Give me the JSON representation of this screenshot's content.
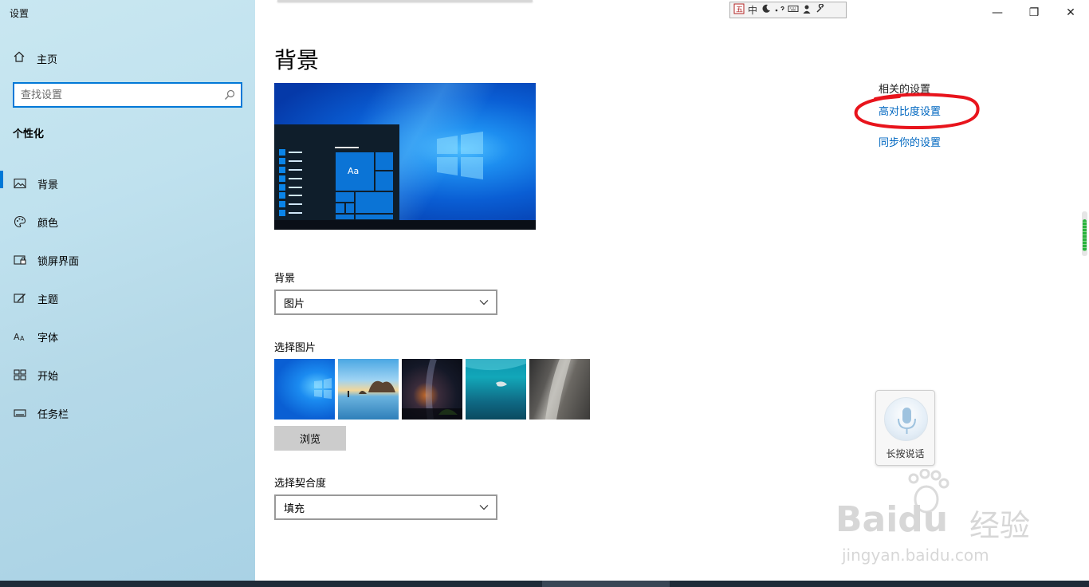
{
  "app": {
    "title": "设置"
  },
  "sidebar": {
    "home_label": "主页",
    "search": {
      "placeholder": "查找设置"
    },
    "section_title": "个性化",
    "items": [
      {
        "label": "背景",
        "icon": "picture-icon",
        "active": true
      },
      {
        "label": "颜色",
        "icon": "palette-icon",
        "active": false
      },
      {
        "label": "锁屏界面",
        "icon": "lockscreen-icon",
        "active": false
      },
      {
        "label": "主题",
        "icon": "theme-icon",
        "active": false
      },
      {
        "label": "字体",
        "icon": "font-icon",
        "active": false
      },
      {
        "label": "开始",
        "icon": "start-icon",
        "active": false
      },
      {
        "label": "任务栏",
        "icon": "taskbar-icon",
        "active": false
      }
    ]
  },
  "ime_bar": {
    "mode": "中",
    "icons": [
      "ime-logo-icon",
      "moon-icon",
      "punctuation-icon",
      "keyboard-icon",
      "user-icon",
      "wrench-icon"
    ]
  },
  "window_controls": {
    "minimize": "—",
    "restore": "❐",
    "close": "✕"
  },
  "main": {
    "title": "背景",
    "preview": {
      "tile_text": "Aa"
    },
    "background_label": "背景",
    "background_value": "图片",
    "choose_picture_label": "选择图片",
    "browse_label": "浏览",
    "fit_label": "选择契合度",
    "fit_value": "填充"
  },
  "related": {
    "heading": "相关的设置",
    "links": [
      "高对比度设置",
      "同步你的设置"
    ],
    "annotation_color": "#e8141c"
  },
  "voice_widget": {
    "caption": "长按说话"
  },
  "watermark": {
    "brand": "Baidu",
    "cn": "经验",
    "url": "jingyan.baidu.com"
  },
  "colors": {
    "accent": "#0078d7",
    "link": "#0067c0"
  }
}
